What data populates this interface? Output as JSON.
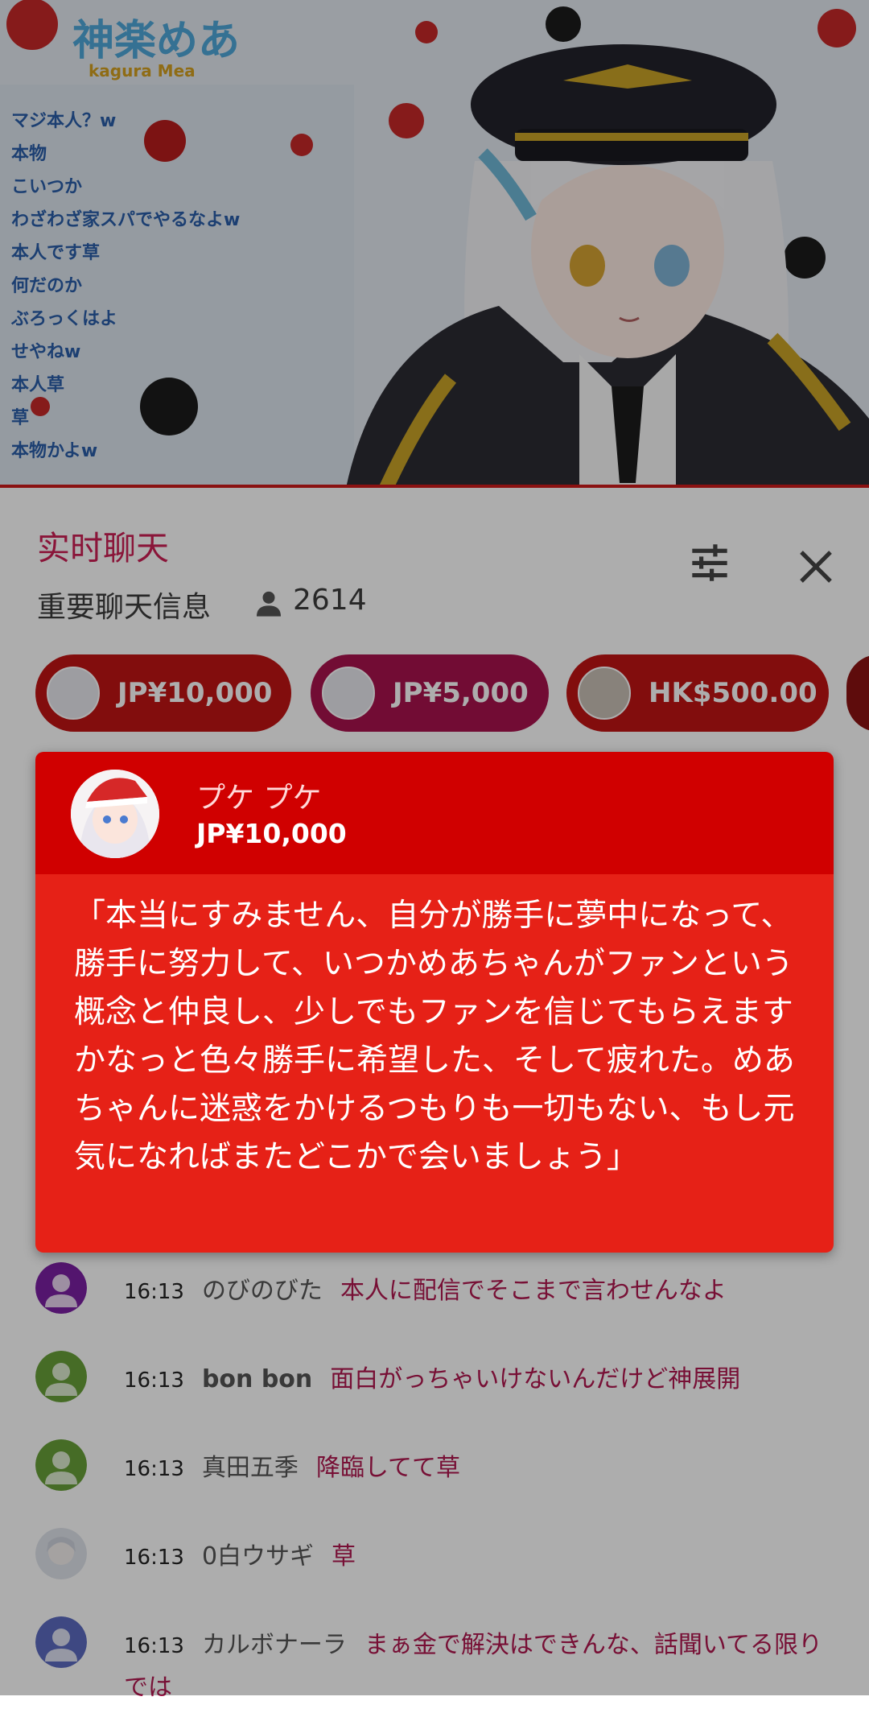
{
  "stream": {
    "logo_text": "神楽めあ",
    "logo_sub": "kagura Mea",
    "chat_lines": [
      "マジ本人？w",
      "本物",
      "こいつか",
      "わざわざ家スパでやるなよw",
      "本人です草",
      "何だのか",
      "ぶろっくはよ",
      "せやねw",
      "本人草",
      "草",
      "本物かよw"
    ]
  },
  "header": {
    "title": "实时聊天",
    "subtitle": "重要聊天信息",
    "viewer_count": "2614"
  },
  "ticker": [
    {
      "amount": "JP¥10,000",
      "color": "#c01414"
    },
    {
      "amount": "JP¥5,000",
      "color": "#a8124d"
    },
    {
      "amount": "HK$500.00",
      "color": "#c01414"
    }
  ],
  "superchat": {
    "author": "プケ プケ",
    "amount": "JP¥10,000",
    "message": "「本当にすみません、自分が勝手に夢中になって、勝手に努力して、いつかめあちゃんがファンという概念と仲良し、少しでもファンを信じてもらえますかなっと色々勝手に希望した、そして疲れた。めあちゃんに迷惑をかけるつもりも一切もない、もし元気になればまたどこかで会いましょう」",
    "header_color": "#d00000",
    "body_color": "#e62117"
  },
  "messages": [
    {
      "time": "16:13",
      "author": "のびのびた",
      "text": "本人に配信でそこまで言わせんなよ",
      "avatar_color": "#7b1fa2"
    },
    {
      "time": "16:13",
      "author": "bon bon",
      "text": "面白がっちゃいけないんだけど神展開",
      "avatar_color": "#689f38"
    },
    {
      "time": "16:13",
      "author": "真田五季",
      "text": "降臨してて草",
      "avatar_color": "#689f38"
    },
    {
      "time": "16:13",
      "author": "0白ウサギ",
      "text": "草",
      "avatar_color": "#dcdcdc"
    },
    {
      "time": "16:13",
      "author": "カルボナーラ",
      "text": "まぁ金で解決はできんな、話聞いてる限りでは",
      "avatar_color": "#5c6bc0"
    }
  ]
}
